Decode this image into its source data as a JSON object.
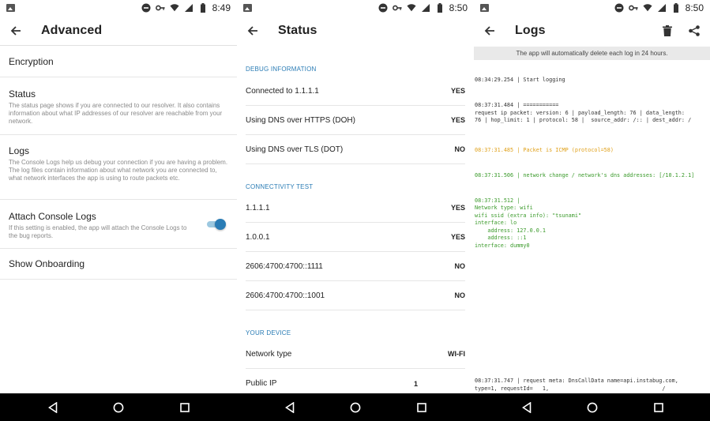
{
  "screens": [
    {
      "status_time": "8:49",
      "title": "Advanced",
      "items": [
        {
          "title": "Encryption",
          "desc": ""
        },
        {
          "title": "Status",
          "desc": "The status page shows if you are connected to our resolver. It also contains information about what IP addresses of our resolver are reachable from your network."
        },
        {
          "title": "Logs",
          "desc": "The Console Logs help us debug your connection if you are having a problem. The log files contain information about what network you are connected to, what network interfaces the app is using to route packets etc."
        },
        {
          "title": "Attach Console Logs",
          "desc": "If this setting is enabled, the app will attach the Console Logs to the bug reports.",
          "toggle_on": true
        },
        {
          "title": "Show Onboarding",
          "desc": ""
        }
      ]
    },
    {
      "status_time": "8:50",
      "title": "Status",
      "sections": [
        {
          "header": "DEBUG INFORMATION",
          "rows": [
            {
              "label": "Connected to 1.1.1.1",
              "value": "YES"
            },
            {
              "label": "Using DNS over HTTPS (DOH)",
              "value": "YES"
            },
            {
              "label": "Using DNS over TLS (DOT)",
              "value": "NO"
            }
          ]
        },
        {
          "header": "CONNECTIVITY TEST",
          "rows": [
            {
              "label": "1.1.1.1",
              "value": "YES"
            },
            {
              "label": "1.0.0.1",
              "value": "YES"
            },
            {
              "label": "2606:4700:4700::1111",
              "value": "NO"
            },
            {
              "label": "2606:4700:4700::1001",
              "value": "NO"
            }
          ]
        },
        {
          "header": "YOUR DEVICE",
          "rows": [
            {
              "label": "Network type",
              "value": "WI-FI"
            },
            {
              "label": "Public IP",
              "value": "1"
            }
          ]
        }
      ]
    },
    {
      "status_time": "8:50",
      "title": "Logs",
      "banner": "The app will automatically delete each log in 24 hours.",
      "log_lines": [
        {
          "text": "08:34:29.254 | Start logging",
          "color": "normal"
        },
        {
          "text": "08:37:31.484 | ===========\nrequest ip packet: version: 6 | payload_length: 76 | data_length:\n76 | hop_limit: 1 | protocol: 58 |  source_addr: /:: | dest_addr: /",
          "color": "normal"
        },
        {
          "text": "08:37:31.485 | Packet is ICMP (protocol=58)",
          "color": "orange"
        },
        {
          "text": "08:37:31.506 | network change / network's dns addresses: [/10.1.2.1]",
          "color": "green"
        },
        {
          "text": "08:37:31.512 |\nNetwork type: wifi\nwifi ssid (extra info): \"tsunami\"\ninterface: lo\n    address: 127.0.0.1\n    address: ::1\ninterface: dummy0",
          "color": "green"
        }
      ],
      "log_bottom": "08:37:31.747 | request meta: DnsCallData name=api.instabug.com,\ntype=1, requestId=   1,                                   /"
    }
  ],
  "colors": {
    "accent": "#2a7cb5",
    "log_orange": "#e0a11b",
    "log_green": "#3a9a2a"
  }
}
